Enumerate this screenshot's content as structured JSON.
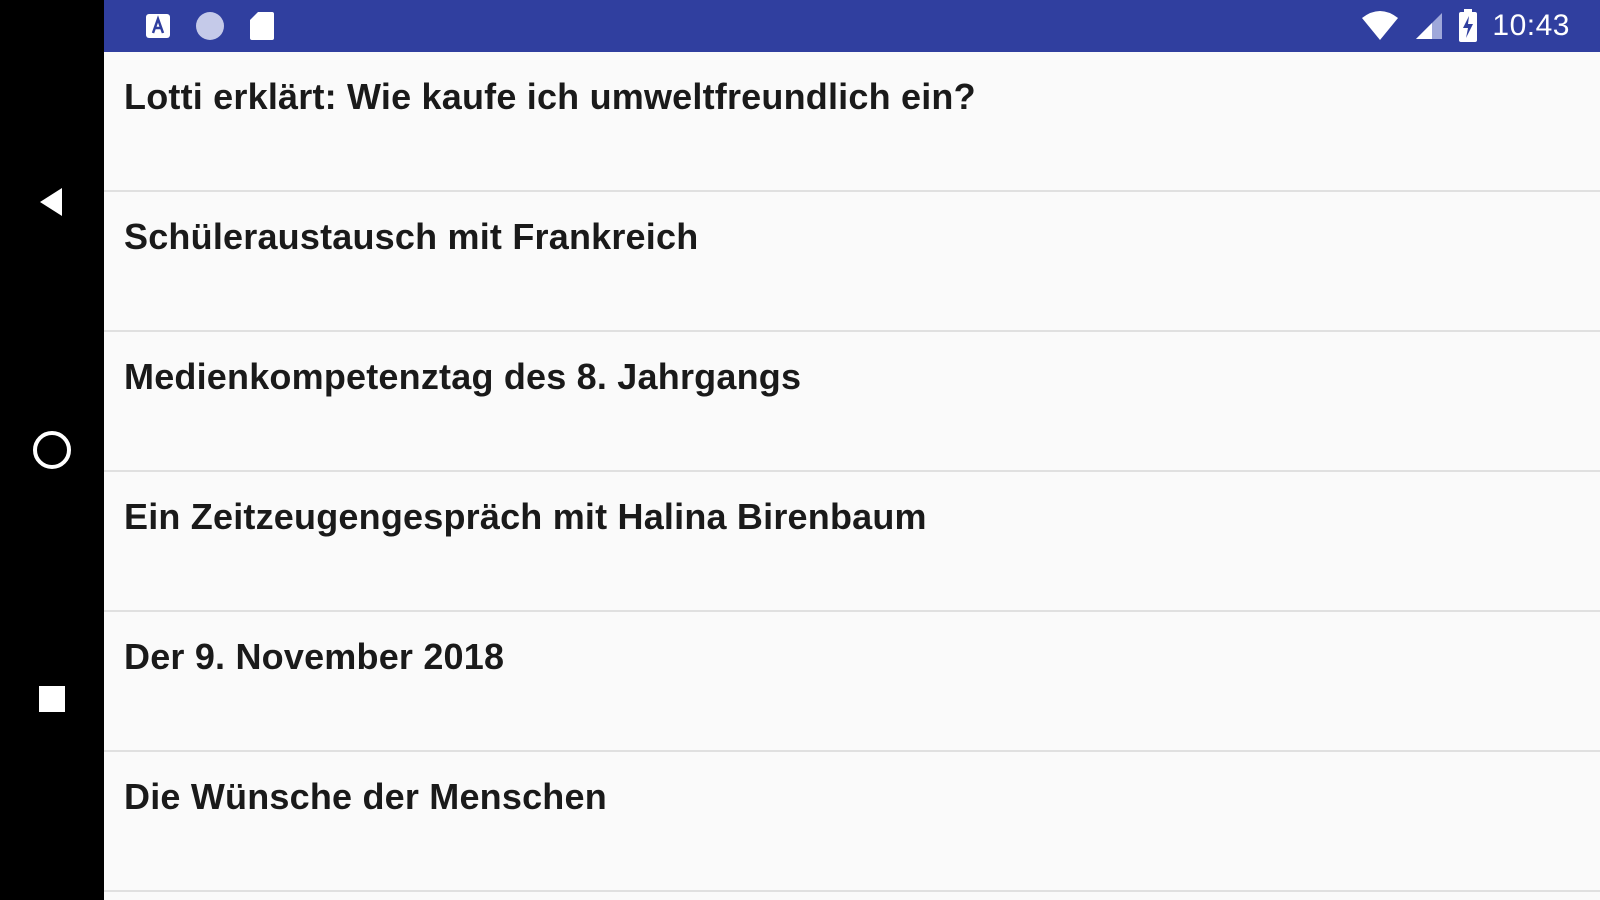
{
  "status_bar": {
    "background_color": "#303F9F",
    "left_icons": [
      "app-a-icon",
      "circle-icon",
      "sd-card-icon"
    ],
    "right_icons": [
      "wifi-icon",
      "cell-signal-icon",
      "battery-charging-icon"
    ],
    "time": "10:43"
  },
  "navigation_bar": {
    "buttons": [
      {
        "name": "back",
        "icon": "back-triangle-icon"
      },
      {
        "name": "home",
        "icon": "home-circle-icon"
      },
      {
        "name": "recents",
        "icon": "recents-square-icon"
      }
    ]
  },
  "list": {
    "items": [
      {
        "title": "Lotti erklärt: Wie kaufe ich umweltfreundlich ein?"
      },
      {
        "title": "Schüleraustausch mit Frankreich"
      },
      {
        "title": "Medienkompetenztag des 8. Jahrgangs"
      },
      {
        "title": "Ein Zeitzeugengespräch mit Halina Birenbaum"
      },
      {
        "title": "Der 9. November 2018"
      },
      {
        "title": "Die Wünsche der Menschen"
      }
    ]
  }
}
